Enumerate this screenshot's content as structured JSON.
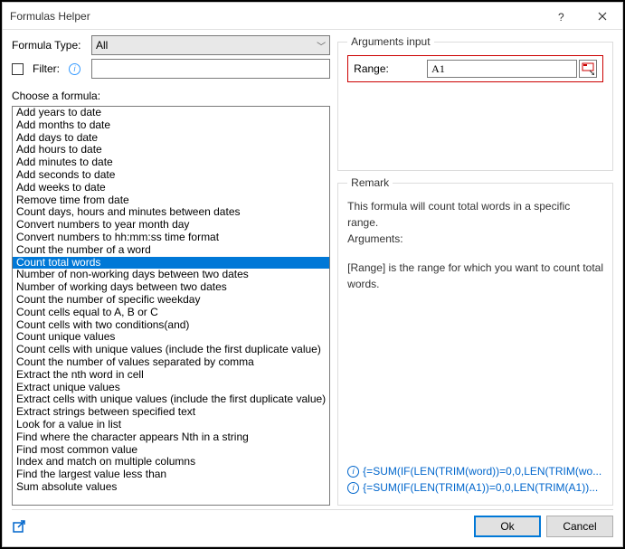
{
  "window": {
    "title": "Formulas Helper"
  },
  "formula_type": {
    "label": "Formula Type:",
    "value": "All"
  },
  "filter": {
    "label": "Filter:",
    "value": ""
  },
  "choose_label": "Choose a formula:",
  "formulas": {
    "items": [
      "Add years to date",
      "Add months to date",
      "Add days to date",
      "Add hours to date",
      "Add minutes to date",
      "Add seconds to date",
      "Add weeks to date",
      "Remove time from date",
      "Count days, hours and minutes between dates",
      "Convert numbers to year month day",
      "Convert numbers to hh:mm:ss time format",
      "Count the number of a word",
      "Count total words",
      "Number of non-working days between two dates",
      "Number of working days between two dates",
      "Count the number of specific weekday",
      "Count cells equal to A, B or C",
      "Count cells with two conditions(and)",
      "Count unique values",
      "Count cells with unique values (include the first duplicate value)",
      "Count the number of values separated by comma",
      "Extract the nth word in cell",
      "Extract unique values",
      "Extract cells with unique values (include the first duplicate value)",
      "Extract strings between specified text",
      "Look for a value in list",
      "Find where the character appears Nth in a string",
      "Find most common value",
      "Index and match on multiple columns",
      "Find the largest value less than",
      "Sum absolute values"
    ],
    "selected_index": 12
  },
  "arguments": {
    "legend": "Arguments input",
    "range_label": "Range:",
    "range_value": "A1"
  },
  "remark": {
    "legend": "Remark",
    "line1": "This formula will count total words in a specific range.",
    "line2": "Arguments:",
    "line3": "[Range] is the range for which you want to count total words.",
    "link1": "{=SUM(IF(LEN(TRIM(word))=0,0,LEN(TRIM(wo...",
    "link2": "{=SUM(IF(LEN(TRIM(A1))=0,0,LEN(TRIM(A1))..."
  },
  "buttons": {
    "ok": "Ok",
    "cancel": "Cancel"
  }
}
